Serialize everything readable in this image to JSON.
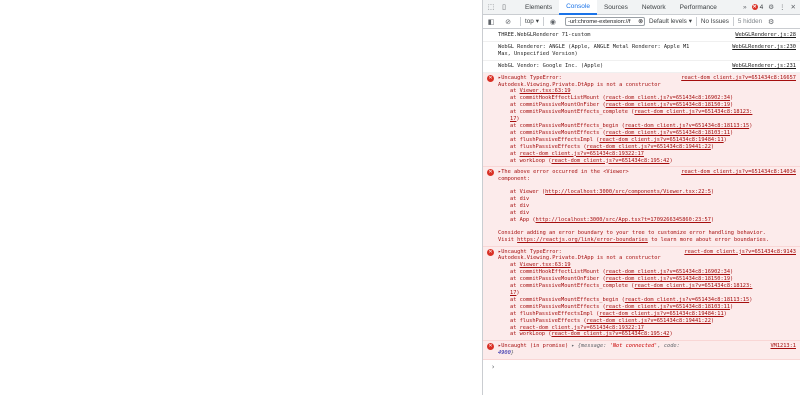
{
  "devtools": {
    "tabs": [
      {
        "label": "Elements"
      },
      {
        "label": "Console"
      },
      {
        "label": "Sources"
      },
      {
        "label": "Network"
      },
      {
        "label": "Performance"
      }
    ],
    "more_tabs": "»",
    "error_count": "4",
    "settings_icon": "⚙",
    "menu_icon": "⋮",
    "close_icon": "✕"
  },
  "toolbar": {
    "context": "top",
    "filter_value": "-url:chrome-extension://f",
    "levels": "Default levels",
    "issues": "No Issues",
    "hidden": "5 hidden"
  },
  "messages": {
    "m1": {
      "text": "THREE.WebGLRenderer 71-custom",
      "src": "WebGLRenderer.js:28"
    },
    "m2": {
      "text": "WebGL Renderer: ANGLE (Apple, ANGLE Metal Renderer: Apple M1 Max, Unspecified Version)",
      "src": "WebGLRenderer.js:230"
    },
    "m3": {
      "text": "WebGL Vendor: Google Inc. (Apple)",
      "src": "WebGLRenderer.js:231"
    },
    "e1": {
      "head": "▸Uncaught TypeError:\nAutodesk.Viewing.Private.DtApp is not a constructor",
      "src": "react-dom_client.js?v=651434c8:16657",
      "frames": [
        {
          "pre": "at ",
          "link": "Viewer.tsx:63:19",
          "post": ""
        },
        {
          "pre": "at commitHookEffectListMount (",
          "link": "react-dom_client.js?v=651434c8:16902:34",
          "post": ")"
        },
        {
          "pre": "at commitPassiveMountOnFiber (",
          "link": "react-dom_client.js?v=651434c8:18150:19",
          "post": ")"
        },
        {
          "pre": "at commitPassiveMountEffects_complete (",
          "link": "react-dom_client.js?v=651434c8:18123:",
          "post": ""
        },
        {
          "pre": "",
          "link": "17",
          "post": ")"
        },
        {
          "pre": "at commitPassiveMountEffects_begin (",
          "link": "react-dom_client.js?v=651434c8:18113:15",
          "post": ")"
        },
        {
          "pre": "at commitPassiveMountEffects (",
          "link": "react-dom_client.js?v=651434c8:18103:11",
          "post": ")"
        },
        {
          "pre": "at flushPassiveEffectsImpl (",
          "link": "react-dom_client.js?v=651434c8:19484:11",
          "post": ")"
        },
        {
          "pre": "at flushPassiveEffects (",
          "link": "react-dom_client.js?v=651434c8:19441:22",
          "post": ")"
        },
        {
          "pre": "at ",
          "link": "react-dom_client.js?v=651434c8:19322:17",
          "post": ""
        },
        {
          "pre": "at workLoop (",
          "link": "react-dom_client.js?v=651434c8:195:42",
          "post": ")"
        }
      ]
    },
    "e2": {
      "head": "▸The above error occurred in the <Viewer>\ncomponent:",
      "src": "react-dom_client.js?v=651434c8:14034",
      "frames": [
        {
          "pre": "at Viewer (",
          "link": "http://localhost:3000/src/components/Viewer.tsx:22:5",
          "post": ")"
        },
        {
          "pre": "at div",
          "link": "",
          "post": ""
        },
        {
          "pre": "at div",
          "link": "",
          "post": ""
        },
        {
          "pre": "at div",
          "link": "",
          "post": ""
        },
        {
          "pre": "at App (",
          "link": "http://localhost:3000/src/App.tsx?t=1709266345860:23:57",
          "post": ")"
        }
      ],
      "tail1": "Consider adding an error boundary to your tree to customize error handling behavior.",
      "tail2_pre": "Visit ",
      "tail2_link": "https://reactjs.org/link/error-boundaries",
      "tail2_post": " to learn more about error boundaries."
    },
    "e3": {
      "head": "▸Uncaught TypeError:\nAutodesk.Viewing.Private.DtApp is not a constructor",
      "src": "react-dom_client.js?v=651434c8:9143",
      "frames": [
        {
          "pre": "at ",
          "link": "Viewer.tsx:63:19",
          "post": ""
        },
        {
          "pre": "at commitHookEffectListMount (",
          "link": "react-dom_client.js?v=651434c8:16902:34",
          "post": ")"
        },
        {
          "pre": "at commitPassiveMountOnFiber (",
          "link": "react-dom_client.js?v=651434c8:18150:19",
          "post": ")"
        },
        {
          "pre": "at commitPassiveMountEffects_complete (",
          "link": "react-dom_client.js?v=651434c8:18123:",
          "post": ""
        },
        {
          "pre": "",
          "link": "17",
          "post": ")"
        },
        {
          "pre": "at commitPassiveMountEffects_begin (",
          "link": "react-dom_client.js?v=651434c8:18113:15",
          "post": ")"
        },
        {
          "pre": "at commitPassiveMountEffects (",
          "link": "react-dom_client.js?v=651434c8:18103:11",
          "post": ")"
        },
        {
          "pre": "at flushPassiveEffectsImpl (",
          "link": "react-dom_client.js?v=651434c8:19484:11",
          "post": ")"
        },
        {
          "pre": "at flushPassiveEffects (",
          "link": "react-dom_client.js?v=651434c8:19441:22",
          "post": ")"
        },
        {
          "pre": "at ",
          "link": "react-dom_client.js?v=651434c8:19322:17",
          "post": ""
        },
        {
          "pre": "at workLoop (",
          "link": "react-dom_client.js?v=651434c8:195:42",
          "post": ")"
        }
      ]
    },
    "e4": {
      "head": "▸Uncaught (in promise) ",
      "obj_open": "▸ {message: ",
      "obj_str": "'Not connected'",
      "obj_mid": ", code: ",
      "obj_num": "4900",
      "obj_close": "}",
      "src": "VM1213:1"
    }
  },
  "prompt": "›"
}
